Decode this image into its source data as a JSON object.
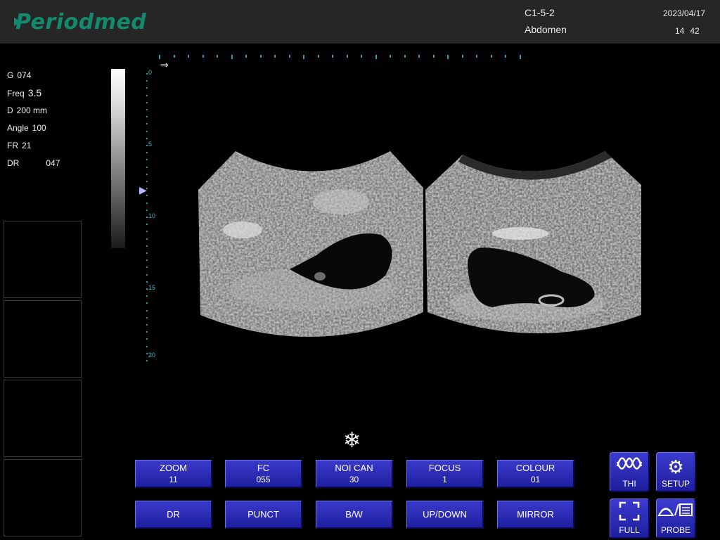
{
  "header": {
    "logo_text": "Periodmed",
    "probe": "C1-5-2",
    "preset": "Abdomen",
    "date": "2023/04/17",
    "time_hour": "14",
    "time_min": "42",
    "brand_color": "#138a6e"
  },
  "params": {
    "gain": {
      "key": "G",
      "value": "074"
    },
    "freq": {
      "key": "Freq",
      "value": "3.5"
    },
    "depth": {
      "key": "D",
      "value": "200 mm"
    },
    "angle": {
      "key": "Angle",
      "value": "100"
    },
    "frame_rate": {
      "key": "FR",
      "value": "21"
    },
    "dynamic_range": {
      "key": "DR",
      "value": "047"
    }
  },
  "depth_scale": {
    "labels": [
      "0",
      "5",
      "10",
      "15",
      "20"
    ]
  },
  "status": {
    "freeze_icon": "snowflake-icon"
  },
  "controls": {
    "row1": [
      {
        "label": "ZOOM",
        "value": "11"
      },
      {
        "label": "FC",
        "value": "055"
      },
      {
        "label": "NOI CAN",
        "value": "30"
      },
      {
        "label": "FOCUS",
        "value": "1"
      },
      {
        "label": "COLOUR",
        "value": "01"
      }
    ],
    "row2": [
      {
        "label": "DR"
      },
      {
        "label": "PUNCT"
      },
      {
        "label": "B/W"
      },
      {
        "label": "UP/DOWN"
      },
      {
        "label": "MIRROR"
      }
    ],
    "side": {
      "thi": "THI",
      "setup": "SETUP",
      "full": "FULL",
      "probe": "PROBE"
    },
    "button_color": "#2a2ab8"
  }
}
